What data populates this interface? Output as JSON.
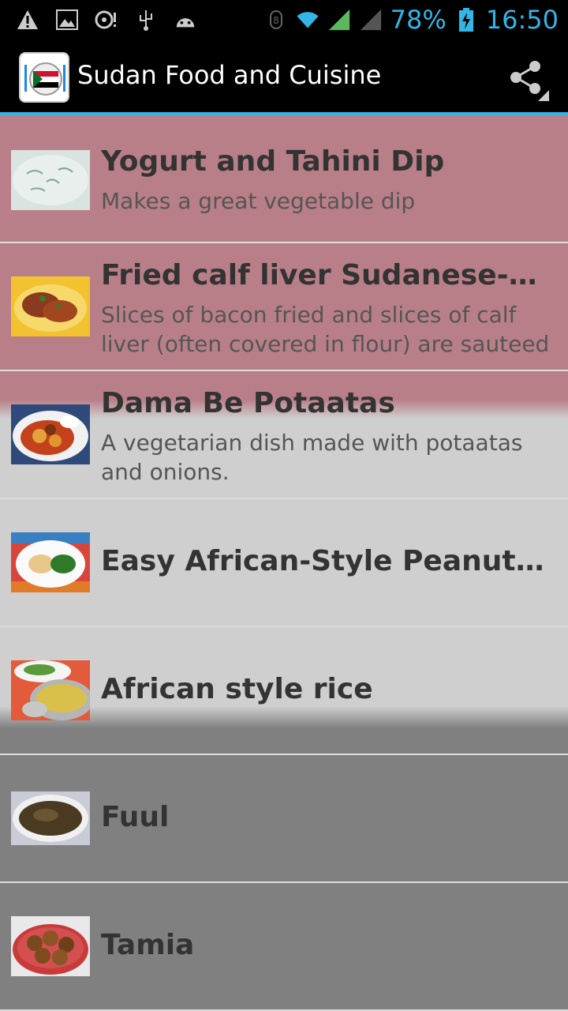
{
  "status_bar": {
    "battery": "78%",
    "time": "16:50",
    "icons_left": [
      "warning-icon",
      "image-icon",
      "voicemail-icon",
      "usb-icon",
      "android-icon"
    ],
    "icons_right": [
      "data-icon",
      "wifi-icon",
      "signal-icon",
      "signal-icon-2",
      "battery-icon"
    ]
  },
  "action_bar": {
    "title": "Sudan Food and Cuisine",
    "app_icon": "sudan-flag-plate-icon",
    "share_icon": "share-icon"
  },
  "colors": {
    "accent": "#33b5e5",
    "highlight_row": "#b97f88",
    "row_light": "#cfcfcf",
    "row_dark": "#808080"
  },
  "recipes": [
    {
      "title": "Yogurt and Tahini Dip",
      "subtitle": "Makes a great vegetable dip",
      "thumb": "yogurt-dip-thumbnail"
    },
    {
      "title": "Fried calf liver Sudanese-style",
      "subtitle": "Slices of bacon fried and slices of calf liver (often covered in flour) are sauteed",
      "thumb": "fried-liver-thumbnail"
    },
    {
      "title": "Dama Be Potaatas",
      "subtitle": "A vegetarian dish made with potaatas and onions.",
      "thumb": "dama-potatoes-thumbnail"
    },
    {
      "title": "Easy African-Style Peanut Chi…",
      "subtitle": "",
      "thumb": "peanut-chicken-thumbnail"
    },
    {
      "title": "African style rice",
      "subtitle": "",
      "thumb": "african-rice-thumbnail"
    },
    {
      "title": "Fuul",
      "subtitle": "",
      "thumb": "fuul-thumbnail"
    },
    {
      "title": "Tamia",
      "subtitle": "",
      "thumb": "tamia-thumbnail"
    }
  ]
}
